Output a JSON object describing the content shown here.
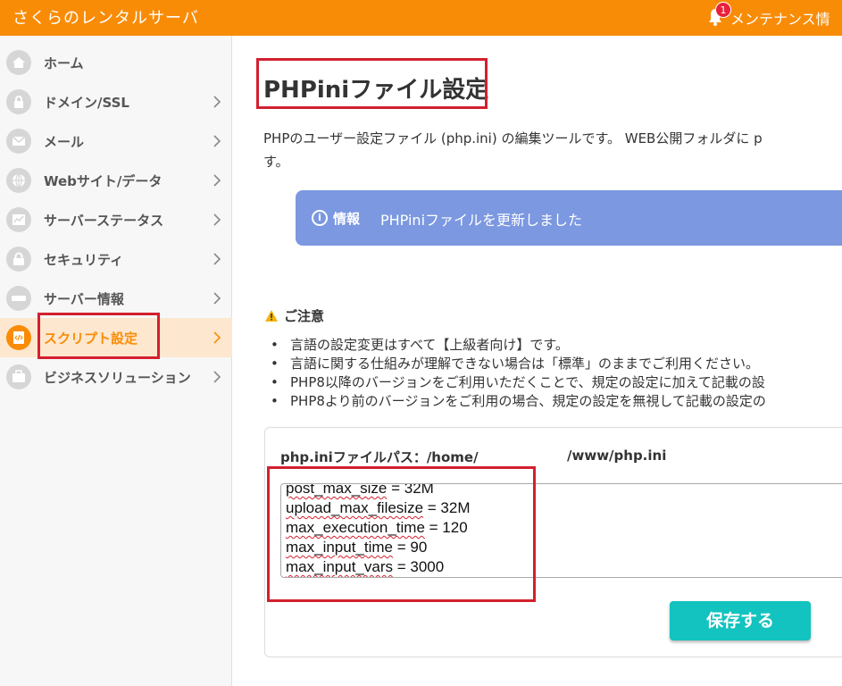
{
  "header": {
    "brand": "さくらのレンタルサーバ",
    "notification_count": "1",
    "maintenance_label": "メンテナンス情"
  },
  "sidebar": {
    "items": [
      {
        "label": "ホーム",
        "icon": "home-icon"
      },
      {
        "label": "ドメイン/SSL",
        "icon": "lock-icon"
      },
      {
        "label": "メール",
        "icon": "mail-icon"
      },
      {
        "label": "Webサイト/データ",
        "icon": "globe-icon"
      },
      {
        "label": "サーバーステータス",
        "icon": "chart-icon"
      },
      {
        "label": "セキュリティ",
        "icon": "padlock-icon"
      },
      {
        "label": "サーバー情報",
        "icon": "server-icon"
      },
      {
        "label": "スクリプト設定",
        "icon": "code-icon",
        "active": true
      },
      {
        "label": "ビジネスソリューション",
        "icon": "briefcase-icon"
      }
    ]
  },
  "main": {
    "title": "PHPiniファイル設定",
    "intro_line1": "PHPのユーザー設定ファイル (php.ini) の編集ツールです。 WEB公開フォルダに p",
    "intro_line2": "す。",
    "info": {
      "label": "情報",
      "message": "PHPiniファイルを更新しました"
    },
    "caution": {
      "title": "ご注意",
      "items": [
        "言語の設定変更はすべて【上級者向け】です。",
        "言語に関する仕組みが理解できない場合は「標準」のままでご利用ください。",
        "PHP8以降のバージョンをご利用いただくことで、規定の設定に加えて記載の設",
        "PHP8より前のバージョンをご利用の場合、規定の設定を無視して記載の設定の"
      ]
    },
    "path_label": "php.iniファイルパス：/home/",
    "path_tail": "/www/php.ini",
    "editor_lines": [
      {
        "key": "post_max_size",
        "value": " = 32M"
      },
      {
        "key": "upload_max_filesize",
        "value": " = 32M"
      },
      {
        "key": "max_execution_time",
        "value": " = 120"
      },
      {
        "key": "max_input_time",
        "value": " = 90"
      },
      {
        "key": "max_input_vars",
        "value": " = 3000"
      }
    ],
    "save_label": "保存する"
  },
  "colors": {
    "brand_orange": "#f98c07",
    "info_blue": "#7b98e0",
    "save_teal": "#13c3bf",
    "highlight_red": "#d3202f"
  }
}
